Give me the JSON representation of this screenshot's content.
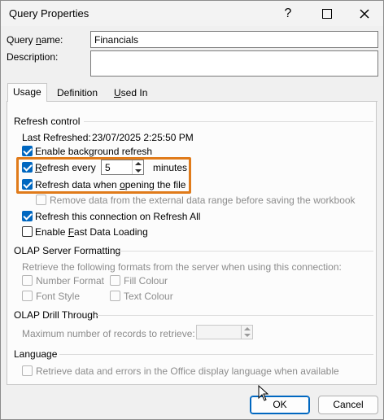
{
  "window": {
    "title": "Query Properties"
  },
  "query_name": {
    "label_pre": "Query ",
    "label_u": "n",
    "label_post": "ame:",
    "value": "Financials"
  },
  "description": {
    "label": "Description:",
    "value": ""
  },
  "tabs": {
    "usage": "Usage",
    "definition": "Definition",
    "used_in_u": "U",
    "used_in_rest": "sed In"
  },
  "refresh_control": {
    "heading": "Refresh control",
    "last_refreshed_label": "Last Refreshed:",
    "last_refreshed_value": "23/07/2025  2:25:50 PM",
    "bg_refresh": {
      "pre": "Enable back",
      "u": "g",
      "post": "round refresh",
      "checked": true
    },
    "refresh_every": {
      "u": "R",
      "post": "efresh every",
      "checked": true,
      "value": "5",
      "unit": "minutes"
    },
    "refresh_on_open": {
      "pre": "Refresh data when ",
      "u": "o",
      "post": "pening the file",
      "checked": true
    },
    "remove_data": {
      "label": "Remove data from the external data range before saving the workbook",
      "checked": false
    },
    "refresh_all": {
      "label": "Refresh this connection on Refresh All",
      "checked": true
    },
    "fast_load": {
      "pre": "Enable ",
      "u": "F",
      "post": "ast Data Loading",
      "checked": false
    }
  },
  "olap_formatting": {
    "heading": "OLAP Server Formatting",
    "subtitle": "Retrieve the following formats from the server when using this connection:",
    "number_format": "Number Format",
    "fill_colour": "Fill Colour",
    "font_style": "Font Style",
    "text_colour": "Text Colour"
  },
  "olap_drill": {
    "heading": "OLAP Drill Through",
    "max_records_label": "Maximum number of records to retrieve:",
    "max_records_value": ""
  },
  "language": {
    "heading": "Language",
    "option": "Retrieve data and errors in the Office display language when available"
  },
  "buttons": {
    "ok": "OK",
    "cancel": "Cancel"
  },
  "colors": {
    "accent": "#0067c0",
    "highlight": "#e07b1a"
  }
}
